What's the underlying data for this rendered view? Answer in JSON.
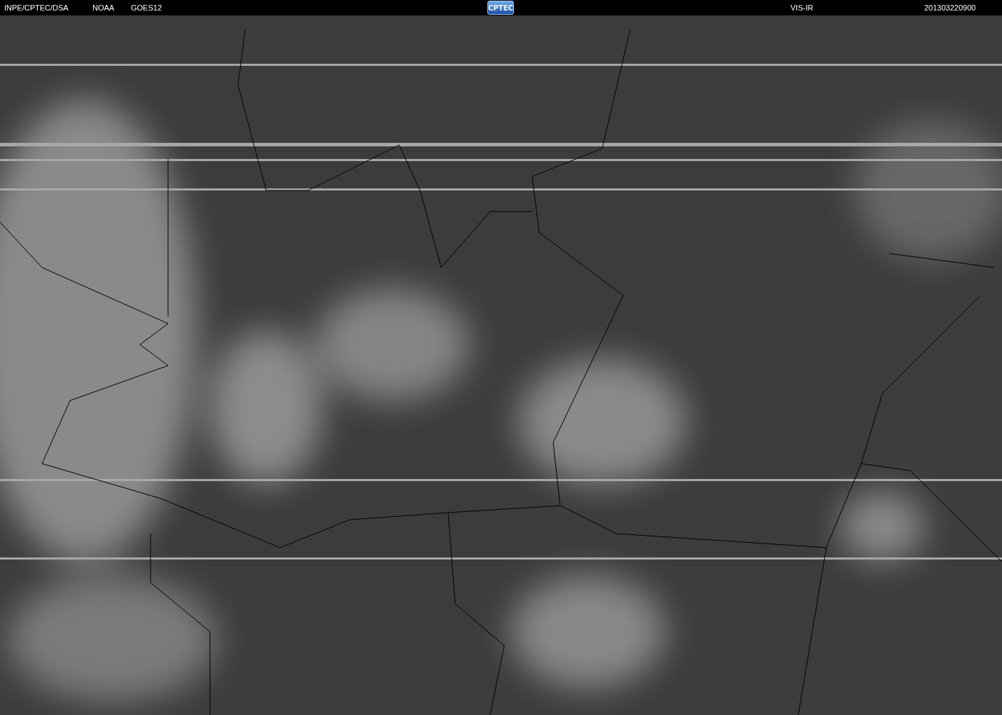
{
  "header": {
    "agency": "INPE/CPTEC/DSA",
    "source": "NOAA",
    "satellite": "GOES12",
    "logo": "CPTEC",
    "channel": "VIS-IR",
    "timestamp": "201303220900"
  }
}
